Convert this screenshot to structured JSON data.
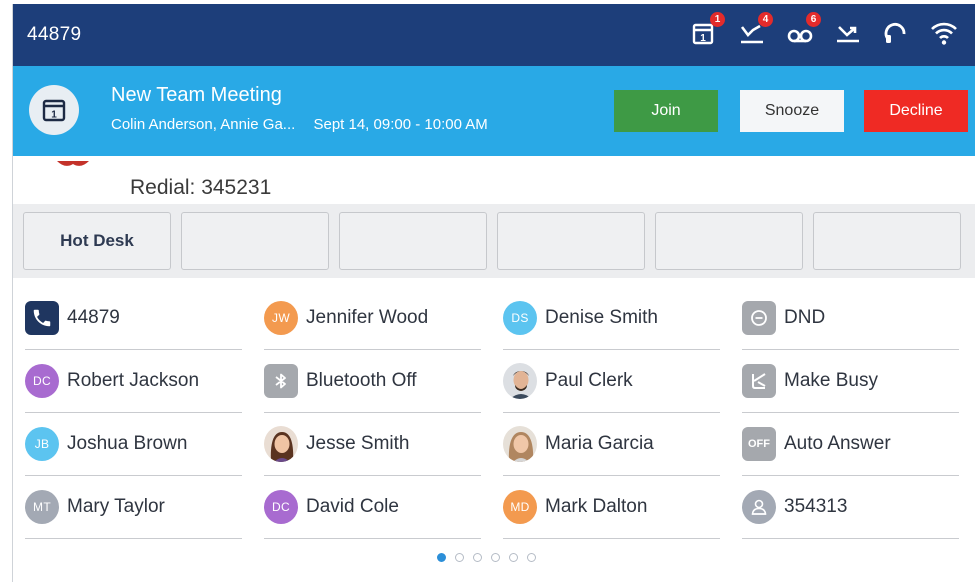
{
  "status_bar": {
    "extension": "44879",
    "icons": [
      {
        "name": "calendar-icon",
        "badge": "1"
      },
      {
        "name": "missed-call-icon",
        "badge": "4"
      },
      {
        "name": "voicemail-icon",
        "badge": "6"
      },
      {
        "name": "call-forward-icon",
        "badge": ""
      },
      {
        "name": "headset-icon",
        "badge": ""
      },
      {
        "name": "wifi-icon",
        "badge": ""
      }
    ]
  },
  "banner": {
    "title": "New Team Meeting",
    "attendees": "Colin Anderson, Annie Ga...",
    "time": "Sept 14, 09:00 - 10:00 AM",
    "join_label": "Join",
    "snooze_label": "Snooze",
    "decline_label": "Decline"
  },
  "redial": "Redial: 345231",
  "softkeys": [
    "Hot Desk",
    "",
    "",
    "",
    "",
    ""
  ],
  "line_keys": [
    [
      {
        "label": "44879",
        "icon": "phone-handset-icon",
        "type": "square",
        "color": "#1f3660"
      },
      {
        "label": "Robert Jackson",
        "icon": "avatar",
        "initials": "DC",
        "type": "avatar",
        "color": "#a86bd0"
      },
      {
        "label": "Joshua Brown",
        "icon": "avatar",
        "initials": "JB",
        "type": "avatar",
        "color": "#5cc4f0"
      },
      {
        "label": "Mary Taylor",
        "icon": "avatar",
        "initials": "MT",
        "type": "avatar",
        "color": "#a3a9b4"
      }
    ],
    [
      {
        "label": "Jennifer Wood",
        "icon": "avatar",
        "initials": "JW",
        "type": "avatar",
        "color": "#f39a4f"
      },
      {
        "label": "Bluetooth Off",
        "icon": "bluetooth-icon",
        "type": "square",
        "color": "#a5a8ad"
      },
      {
        "label": "Jesse Smith",
        "icon": "photo-avatar",
        "type": "photo-female"
      },
      {
        "label": "David Cole",
        "icon": "avatar",
        "initials": "DC",
        "type": "avatar",
        "color": "#a86bd0"
      }
    ],
    [
      {
        "label": "Denise Smith",
        "icon": "avatar",
        "initials": "DS",
        "type": "avatar",
        "color": "#5cc4f0"
      },
      {
        "label": "Paul Clerk",
        "icon": "photo-avatar",
        "type": "photo-male"
      },
      {
        "label": "Maria Garcia",
        "icon": "photo-avatar",
        "type": "photo-female2"
      },
      {
        "label": "Mark Dalton",
        "icon": "avatar",
        "initials": "MD",
        "type": "avatar",
        "color": "#f39a4f"
      }
    ],
    [
      {
        "label": "DND",
        "icon": "dnd-icon",
        "type": "square",
        "color": "#a5a8ad"
      },
      {
        "label": "Make Busy",
        "icon": "make-busy-icon",
        "type": "square",
        "color": "#a5a8ad"
      },
      {
        "label": "Auto Answer",
        "icon": "auto-answer-icon",
        "type": "square-text",
        "text": "OFF",
        "color": "#a5a8ad"
      },
      {
        "label": "354313",
        "icon": "group-icon",
        "type": "circle-icon",
        "color": "#a3a9b4"
      }
    ]
  ],
  "pagination": {
    "pages": 6,
    "current": 1
  }
}
